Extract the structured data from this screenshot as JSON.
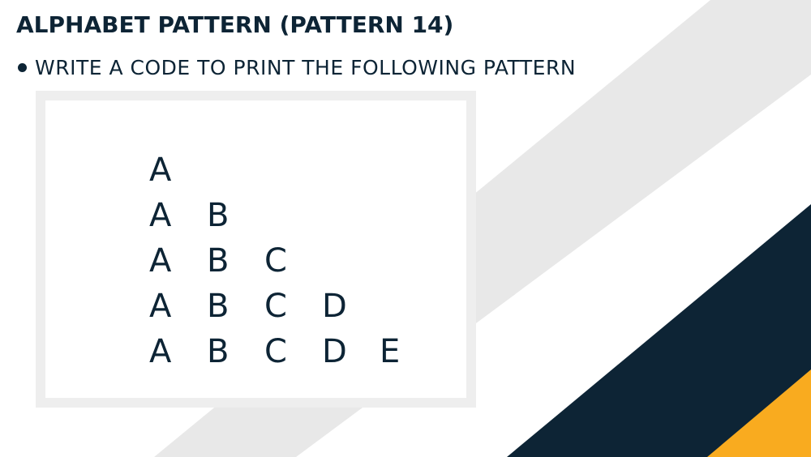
{
  "slide": {
    "title": "ALPHABET PATTERN (PATTERN 14)",
    "bullet": "WRITE A CODE TO PRINT THE FOLLOWING PATTERN",
    "pattern_rows": [
      [
        "A"
      ],
      [
        "A",
        "B"
      ],
      [
        "A",
        "B",
        "C"
      ],
      [
        "A",
        "B",
        "C",
        "D"
      ],
      [
        "A",
        "B",
        "C",
        "D",
        "E"
      ]
    ]
  },
  "colors": {
    "text": "#0d2435",
    "stripe_gray": "#e8e8e8",
    "navy": "#0d2435",
    "accent_yellow": "#f9ab1f",
    "box_border": "#eeeeee"
  }
}
